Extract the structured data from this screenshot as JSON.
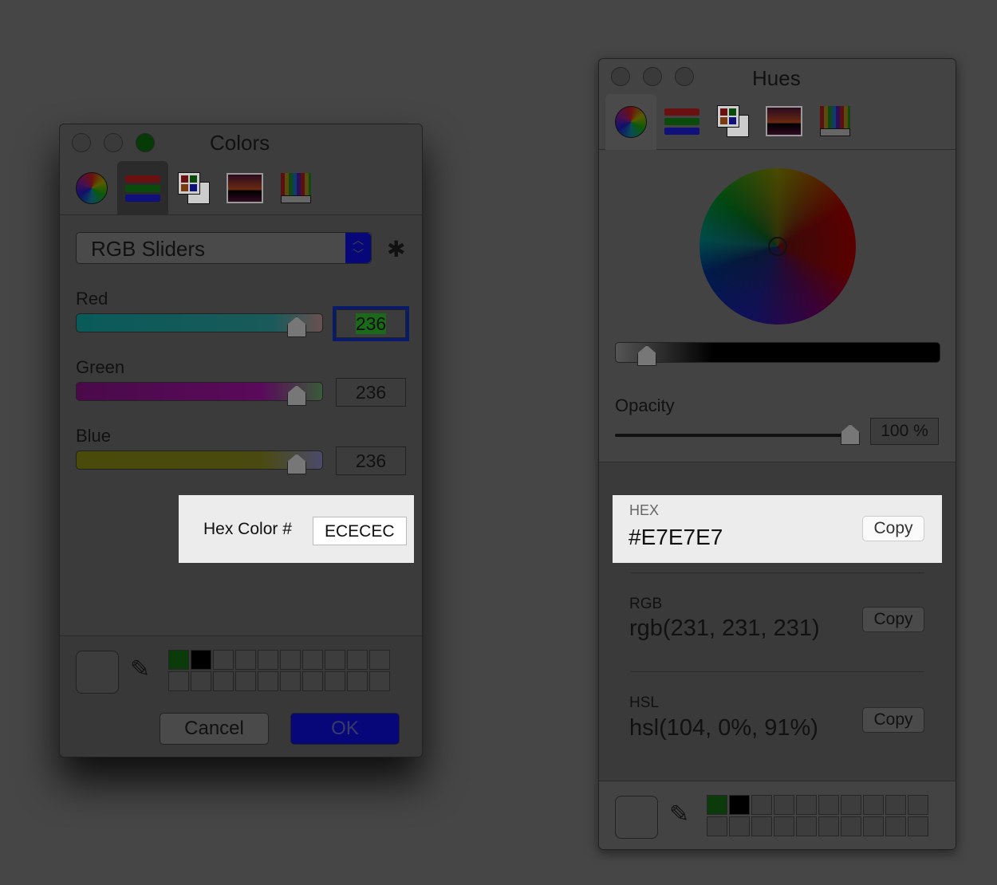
{
  "colors_window": {
    "title": "Colors",
    "mode": "RGB Sliders",
    "sliders": [
      {
        "label": "Red",
        "value": "236"
      },
      {
        "label": "Green",
        "value": "236"
      },
      {
        "label": "Blue",
        "value": "236"
      }
    ],
    "hex_label": "Hex Color #",
    "hex_value": "ECECEC",
    "cancel": "Cancel",
    "ok": "OK",
    "toolbar": [
      "color-wheel",
      "color-sliders",
      "color-palettes",
      "image-palettes",
      "pencils"
    ],
    "selected_tool": "color-sliders",
    "swatches": [
      "#0b3a0b",
      "#000000"
    ]
  },
  "hues_window": {
    "title": "Hues",
    "opacity_label": "Opacity",
    "opacity_value": "100 %",
    "opacity": 1.0,
    "brightness": 0.1,
    "formats": [
      {
        "label": "HEX",
        "value": "#E7E7E7",
        "copy": "Copy"
      },
      {
        "label": "RGB",
        "value": "rgb(231, 231, 231)",
        "copy": "Copy"
      },
      {
        "label": "HSL",
        "value": "hsl(104, 0%, 91%)",
        "copy": "Copy"
      }
    ],
    "selected_tool": "color-wheel",
    "swatches": [
      "#0b3a0b",
      "#000000"
    ]
  }
}
